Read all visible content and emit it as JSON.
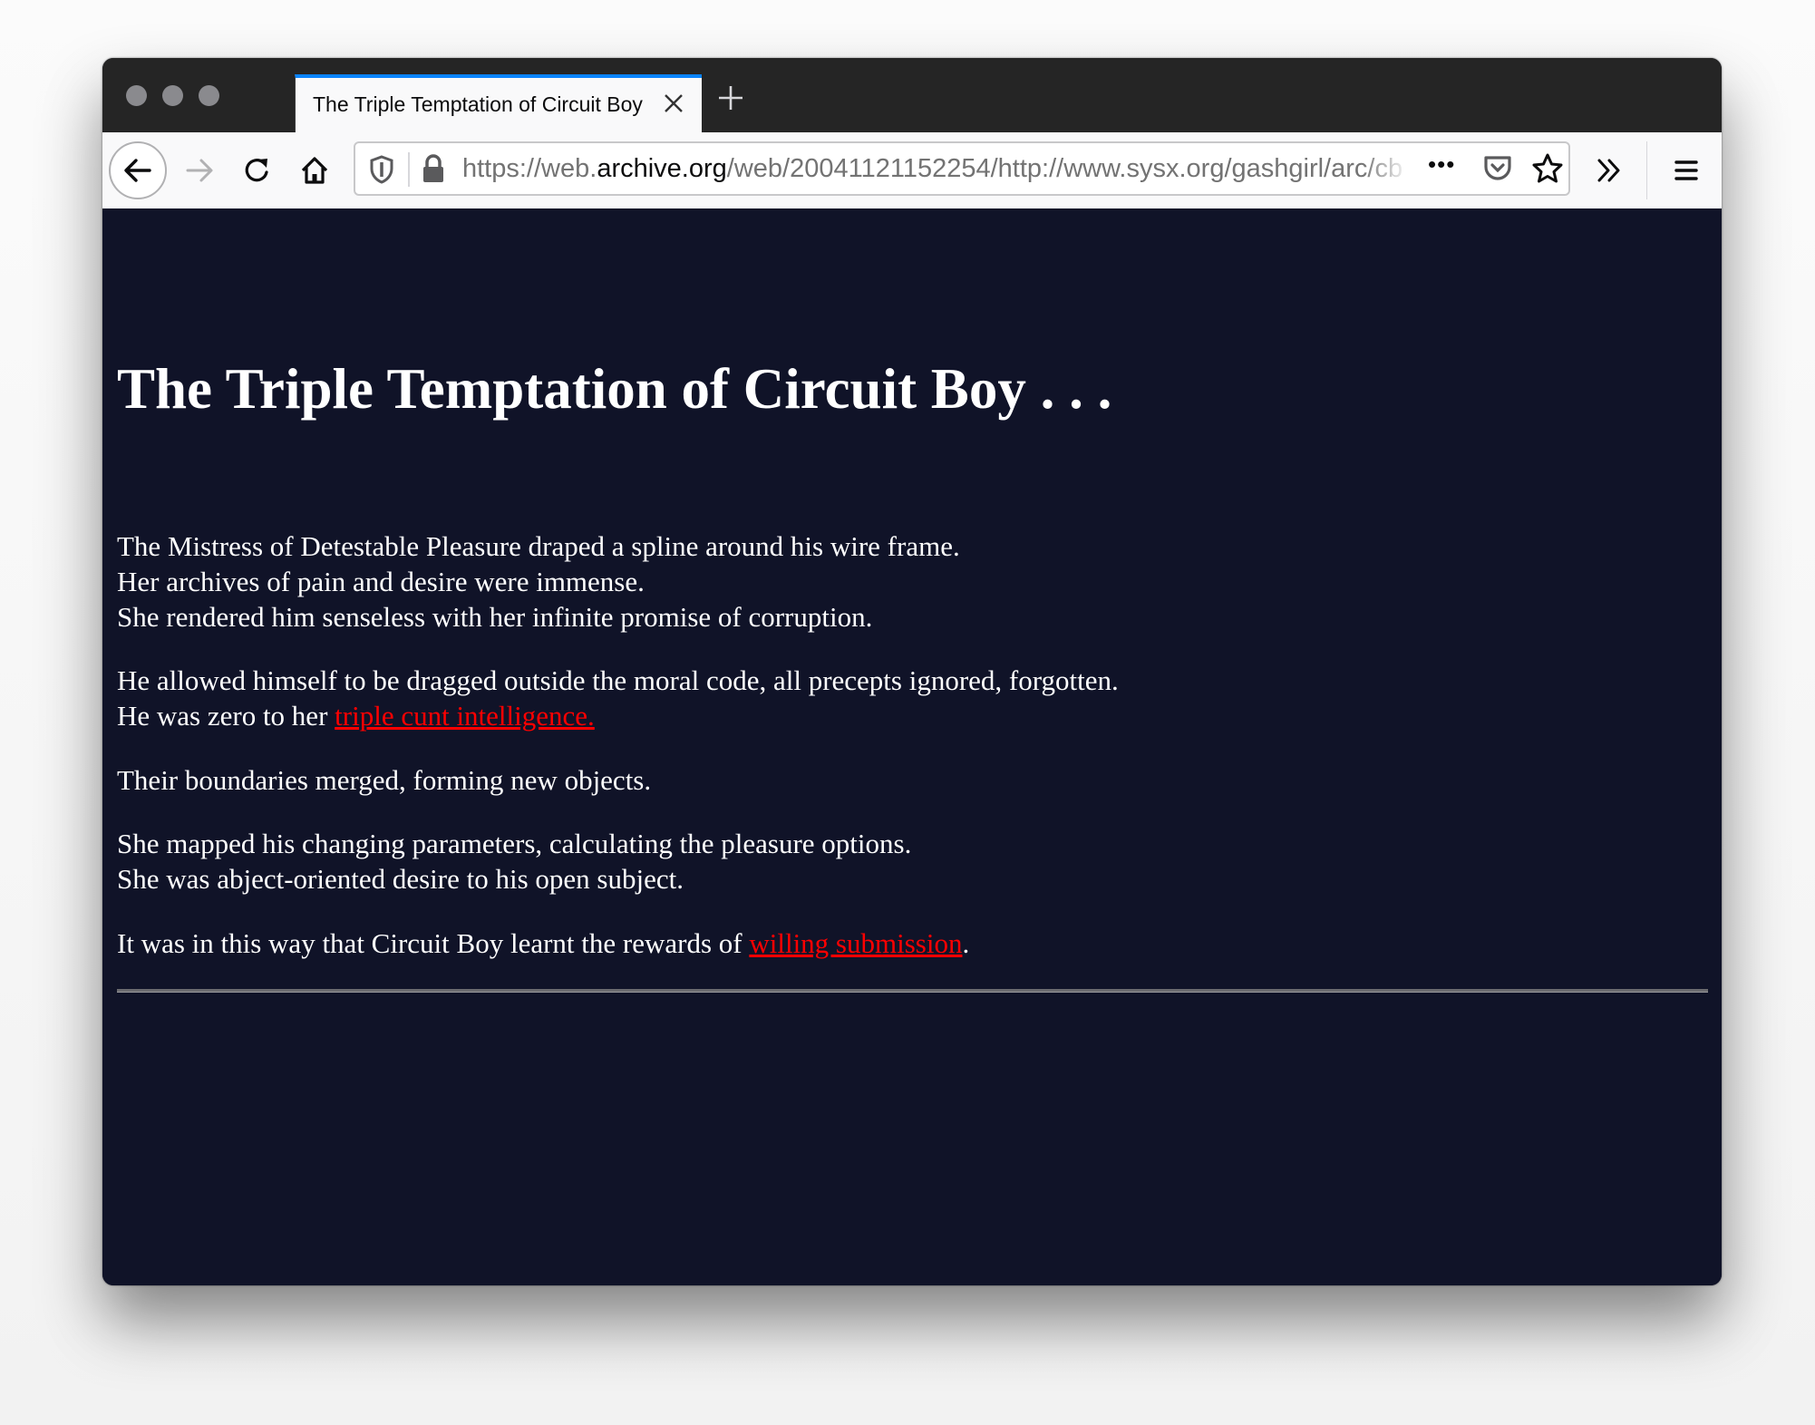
{
  "browser": {
    "tab": {
      "title": "The Triple Temptation of Circuit Boy",
      "close_icon": "close-icon"
    },
    "new_tab_label": "+",
    "url": {
      "prefix": "https://web.",
      "domain": "archive.org",
      "suffix": "/web/20041121152254/http://www.sysx.org/gashgirl/arc/cb"
    },
    "toolbar_icons": [
      "back-arrow-icon",
      "forward-arrow-icon",
      "reload-icon",
      "home-icon",
      "tracking-shield-icon",
      "lock-icon",
      "more-actions-icon",
      "pocket-icon",
      "bookmark-star-icon",
      "overflow-chevrons-icon",
      "hamburger-menu-icon"
    ],
    "more_actions_label": "•••"
  },
  "page": {
    "title": "The Triple Temptation of Circuit Boy . . .",
    "stanzas": [
      {
        "lines": [
          "The Mistress of Detestable Pleasure draped a spline around his wire frame.",
          "Her archives of pain and desire were immense.",
          "She rendered him senseless with her infinite promise of corruption."
        ]
      },
      {
        "line1": "He allowed himself to be dragged outside the moral code, all precepts ignored, forgotten.",
        "line2_prefix": "He was zero to her ",
        "line2_link": "triple cunt intelligence."
      },
      {
        "lines": [
          "Their boundaries merged, forming new objects."
        ]
      },
      {
        "lines": [
          "She mapped his changing parameters, calculating the pleasure options.",
          "She was abject-oriented desire to his open subject."
        ]
      },
      {
        "prefix": "It was in this way that Circuit Boy learnt the rewards of ",
        "link": "willing submission",
        "suffix": "."
      }
    ]
  },
  "colors": {
    "page_background": "#101328",
    "text": "#ffffff",
    "link": "#ff0000",
    "tab_accent": "#0a84ff"
  }
}
